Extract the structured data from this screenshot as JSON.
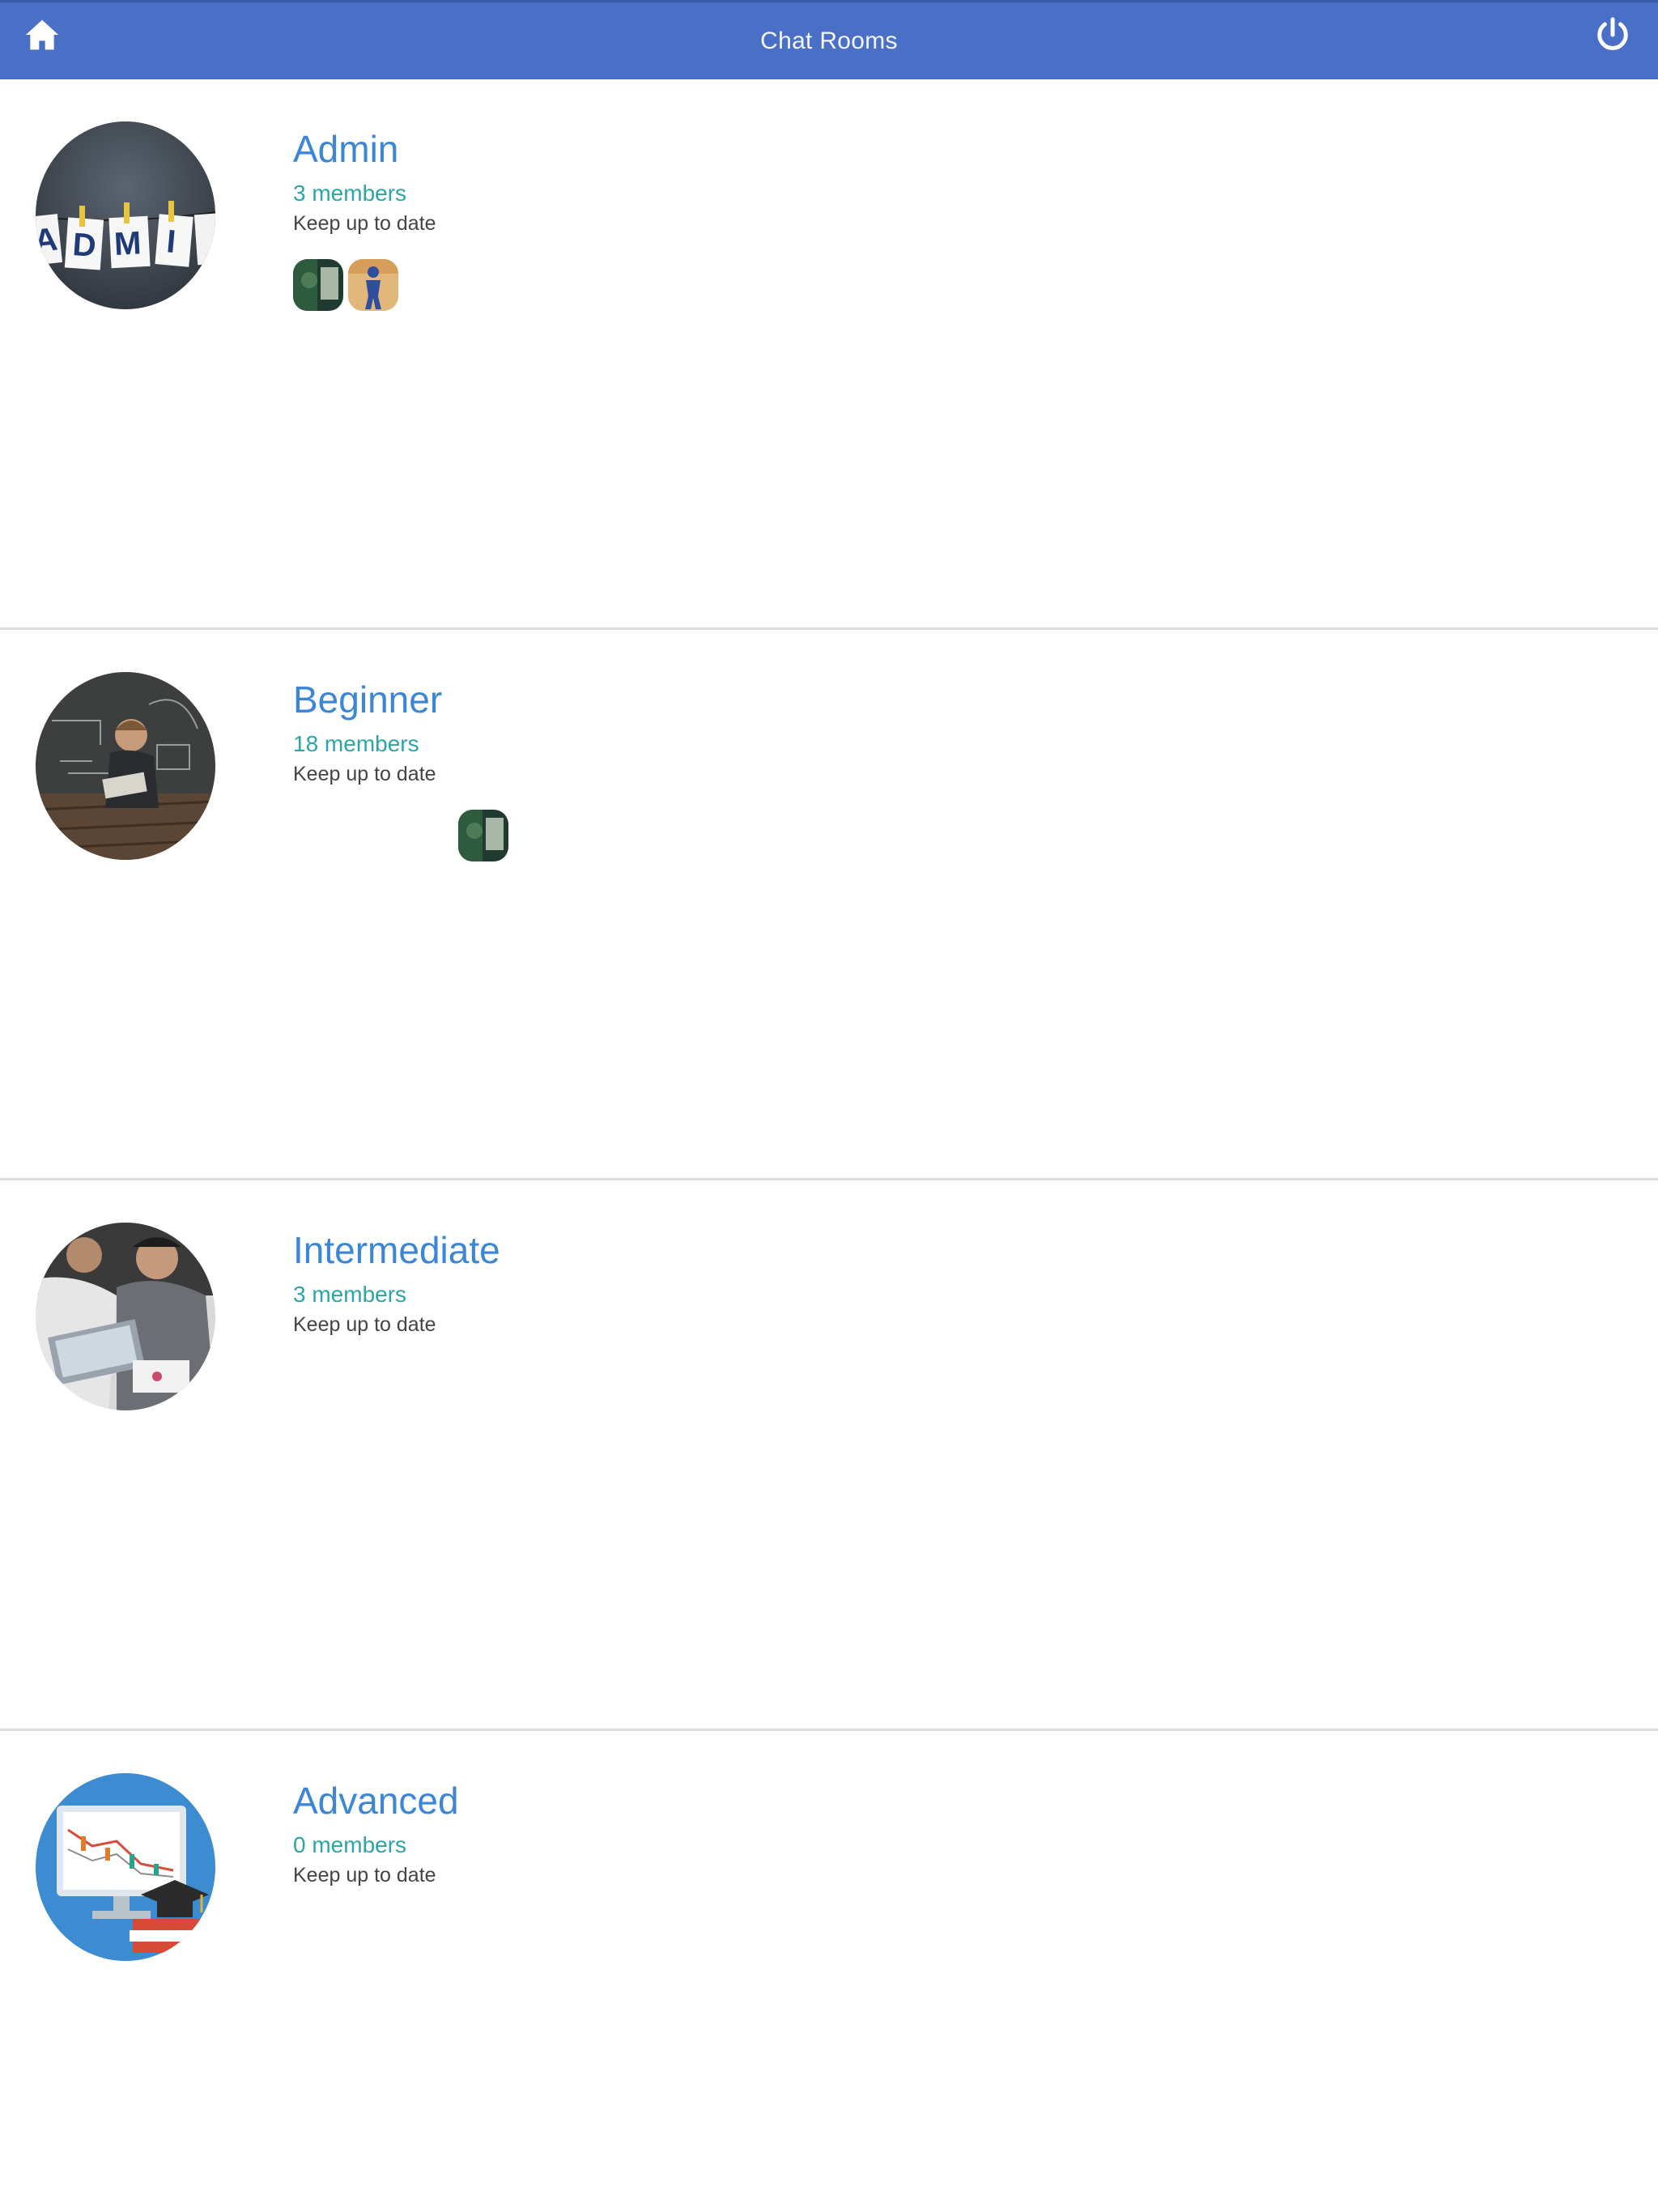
{
  "header": {
    "title": "Chat Rooms",
    "home_icon": "home-icon",
    "power_icon": "power-icon",
    "color": "#4a6fc7"
  },
  "rooms": [
    {
      "name": "Admin",
      "members": "3 members",
      "subtitle": "Keep up to date",
      "avatar": "admin-letters-image",
      "member_thumbnails": [
        "member-thumb-green",
        "member-thumb-blue-figure"
      ]
    },
    {
      "name": "Beginner",
      "members": "18 members",
      "subtitle": "Keep up to date",
      "avatar": "child-reading-chalkboard-image",
      "member_thumbnails": [
        "member-thumb-green"
      ]
    },
    {
      "name": "Intermediate",
      "members": "3 members",
      "subtitle": "Keep up to date",
      "avatar": "people-at-laptops-image",
      "member_thumbnails": []
    },
    {
      "name": "Advanced",
      "members": "0 members",
      "subtitle": "Keep up to date",
      "avatar": "chart-monitor-graduation-cap-image",
      "member_thumbnails": []
    }
  ],
  "colors": {
    "room_name": "#3b86d6",
    "member_count": "#2aa6a8",
    "subtitle": "#444444",
    "divider": "#dcdcdc"
  }
}
